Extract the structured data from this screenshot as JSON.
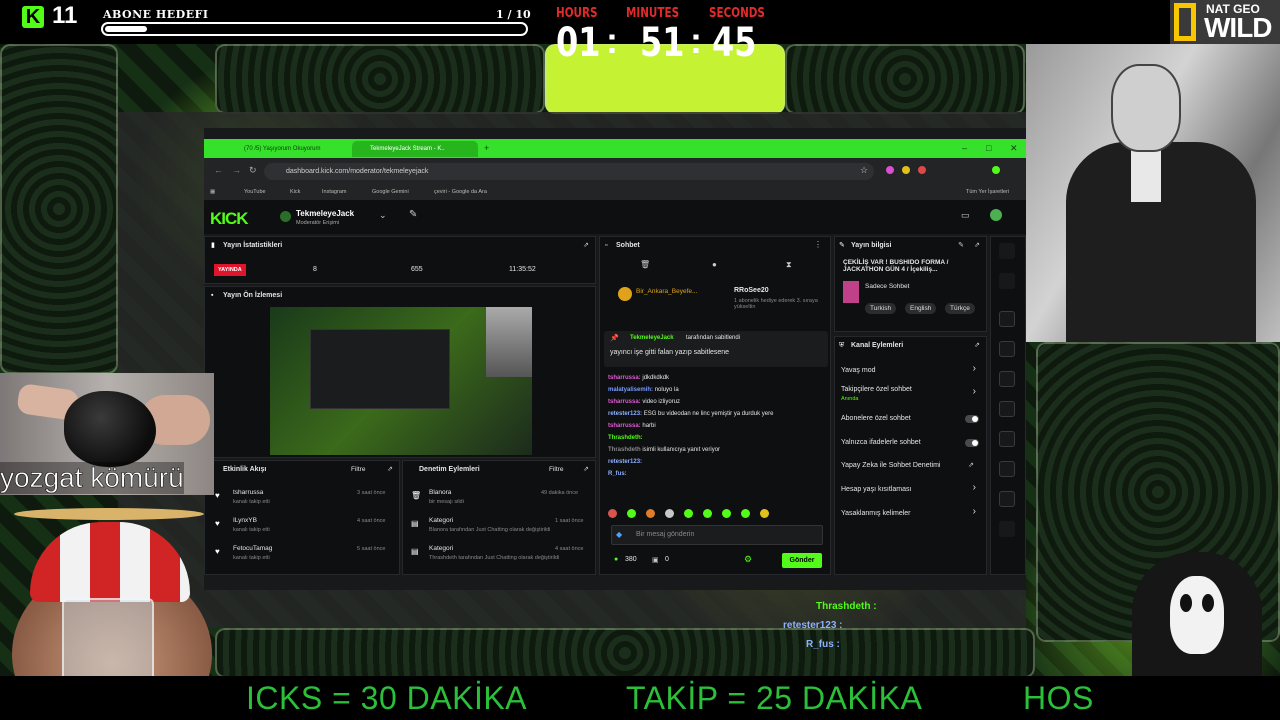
{
  "top_bar": {
    "kick_letter": "K",
    "subscriber_count": "11",
    "goal_title": "ABONE HEDEFI",
    "goal_progress_text": "1 / 10",
    "goal_progress_fraction": 0.1
  },
  "timer": {
    "hours_label": "HOURS",
    "minutes_label": "MINUTES",
    "seconds_label": "SECONDS",
    "hours": "01",
    "minutes": "51",
    "seconds": "45",
    "separator": ":"
  },
  "natgeo": {
    "top": "NAT GEO",
    "bottom": "WILD"
  },
  "browser": {
    "tab1": "(70 /5) Yaşıyorum Okuyorum",
    "tab2": "TekmeleyeJack Stream - K..",
    "url": "dashboard.kick.com/moderator/tekmeleyejack",
    "bookmarks": [
      "YouTube",
      "Kick",
      "Instagram",
      "Google Gemini",
      "çeviri - Google da Ara"
    ],
    "all_bookmarks": "Tüm Yer İşaretleri"
  },
  "dashboard": {
    "logo": "KICK",
    "channel_name": "TekmeleyeJack",
    "channel_role": "Moderatör Erişimi",
    "stats": {
      "title": "Yayın İstatistikleri",
      "live_badge": "YAYINDA",
      "viewers": "8",
      "followers": "655",
      "duration": "11:35:52"
    },
    "preview_title": "Yayın Ön İzlemesi",
    "activity": {
      "title": "Etkinlik Akışı",
      "filter": "Filtre",
      "items": [
        {
          "user": "tsharrussa",
          "action": "kanalı takip etti",
          "time": "3 saat önce"
        },
        {
          "user": "ILynxYB",
          "action": "kanalı takip etti",
          "time": "4 saat önce"
        },
        {
          "user": "FetocuTamag",
          "action": "kanalı takip etti",
          "time": "5 saat önce"
        }
      ]
    },
    "moderation": {
      "title": "Denetim Eylemleri",
      "filter": "Filtre",
      "items": [
        {
          "user": "Blanora",
          "action": "bir mesajı sildi",
          "time": "49 dakika önce"
        },
        {
          "user": "Kategori",
          "action": "Blanora tarafından Just Chatting olarak değiştirildi",
          "time": "1 saat önce"
        },
        {
          "user": "Kategori",
          "action": "Thrashdeth tarafından Just Chatting olarak değiştirildi",
          "time": "4 saat önce"
        }
      ]
    },
    "chat": {
      "title": "Sohbet",
      "gift_user": "Bir_Ankara_Beyefe...",
      "gift_rank_user": "RRoSee20",
      "gift_note": "1 abonelik hediye ederek 3. sıraya yükseltin",
      "pinned_by": "TekmeleyeJack",
      "pinned_suffix": "tarafından sabitlendi",
      "pinned_message": "yayıncı işe gitti falan yazıp sabitlesene",
      "messages": [
        {
          "user": "tsharrussa:",
          "text": "jdkdkdkdk",
          "color": "#e05ad6"
        },
        {
          "user": "malatyalisemih:",
          "text": "noluyo la",
          "color": "#7a9bff"
        },
        {
          "user": "tsharrussa:",
          "text": "video izliyoruz",
          "color": "#e05ad6"
        },
        {
          "user": "retester123:",
          "text": "ESG bu videodan ne linc yemiştir ya durduk yere",
          "color": "#8fb0ff"
        },
        {
          "user": "tsharrussa:",
          "text": "harbi",
          "color": "#e05ad6"
        },
        {
          "user": "Thrashdeth:",
          "text": "",
          "color": "#53fc18"
        },
        {
          "user": "Thrashdeth",
          "text": "isimli kullanıcıya yanıt veriyor",
          "color": "#888888"
        },
        {
          "user": "retester123:",
          "text": "",
          "color": "#8fb0ff"
        },
        {
          "user": "R_fus:",
          "text": "",
          "color": "#8fb0ff"
        }
      ],
      "input_placeholder": "Bir mesaj gönderin",
      "points": "380",
      "count": "0",
      "send_label": "Gönder"
    },
    "stream_info": {
      "title": "Yayın bilgisi",
      "stream_title": "ÇEKİLİŞ VAR ! BUSHIDO FORMA / JACKATHON GÜN 4 / İçekiliş...",
      "category": "Sadece Sohbet",
      "tags": [
        "Turkish",
        "English",
        "Türkçe"
      ]
    },
    "channel_actions": {
      "title": "Kanal Eylemleri",
      "slow_mode": "Yavaş mod",
      "followers_only": "Takipçilere özel sohbet",
      "followers_only_sub": "Anında",
      "subs_only": "Abonelere özel sohbet",
      "emotes_only": "Yalnızca ifadelerle sohbet",
      "ai_moderation": "Yapay Zeka ile Sohbet Denetimi",
      "account_age": "Hesap yaşı kısıtlaması",
      "banned_words": "Yasaklanmış kelimeler"
    }
  },
  "overlays": {
    "coal_label": "yozgat kömürü",
    "chat": [
      {
        "user": "Thrashdeth :",
        "color": "#53fc18"
      },
      {
        "user": "retester123 :",
        "color": "#8fb0ff"
      },
      {
        "user": "R_fus :",
        "color": "#8fb0ff"
      }
    ],
    "ticker": [
      "ICKS = 30 DAKİKA",
      "TAKİP = 25 DAKİKA",
      "HOS"
    ]
  }
}
